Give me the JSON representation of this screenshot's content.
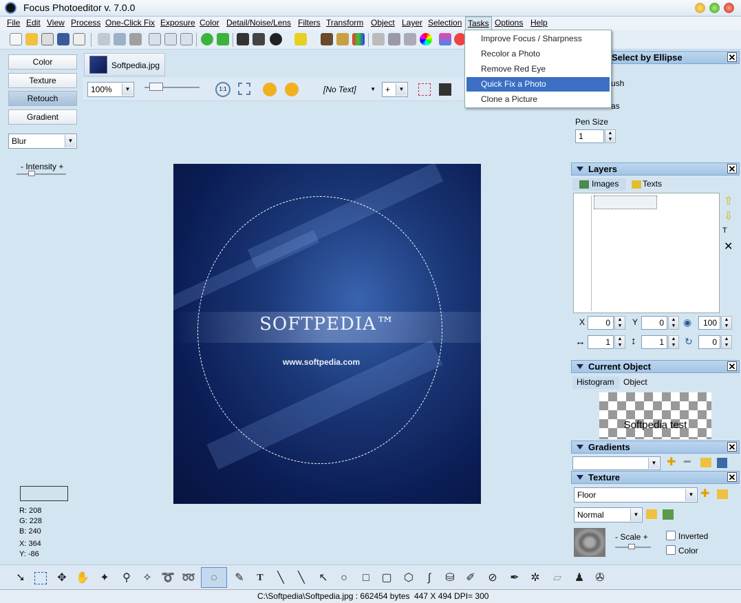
{
  "window": {
    "title": "Focus Photoeditor v. 7.0.0"
  },
  "menu": [
    "File",
    "Edit",
    "View",
    "Process",
    "One-Click Fix",
    "Exposure",
    "Color",
    "Detail/Noise/Lens",
    "Filters",
    "Transform",
    "Object",
    "Layer",
    "Selection",
    "Tasks",
    "Options",
    "Help"
  ],
  "tasks_menu": {
    "items": [
      "Improve Focus / Sharpness",
      "Recolor a Photo",
      "Remove Red Eye",
      "Quick Fix a Photo",
      "Clone a Picture"
    ],
    "selected": "Quick Fix a Photo"
  },
  "left_panel": {
    "buttons": [
      "Color",
      "Texture",
      "Retouch",
      "Gradient"
    ],
    "active": "Retouch",
    "effect_select": "Blur",
    "intensity_label": "- Intensity +",
    "pixel_info": {
      "r": "R: 208",
      "g": "G: 228",
      "b": "B: 240",
      "x": "X: 364",
      "y": "Y: -86"
    }
  },
  "document": {
    "tab_name": "Softpedia.jpg",
    "zoom": "100%",
    "text_select": "[No Text]",
    "plus_select": "+",
    "image_logo": "SOFTPEDIA™",
    "image_url": "www.softpedia.com"
  },
  "tool_panel": {
    "title": "Select by Ellipse",
    "brush_label": "ush",
    "canvas_label": "as",
    "pen_size_label": "Pen Size",
    "pen_size": "1"
  },
  "layers_panel": {
    "title": "Layers",
    "tabs": [
      "Images",
      "Texts"
    ],
    "x_label": "X",
    "x": "0",
    "y_label": "Y",
    "y": "0",
    "opacity": "100",
    "w": "1",
    "h": "1",
    "rot": "0"
  },
  "current_object": {
    "title": "Current Object",
    "tabs": [
      "Histogram",
      "Object"
    ],
    "preview_text": "Softpedia test"
  },
  "gradients_panel": {
    "title": "Gradients"
  },
  "texture_panel": {
    "title": "Texture",
    "texture": "Floor",
    "blend": "Normal",
    "scale_label": "- Scale +",
    "inverted": "Inverted",
    "color": "Color"
  },
  "status": {
    "path": "C:\\Softpedia\\Softpedia.jpg : 662454 bytes",
    "dims": "447 X 494 DPI= 300"
  },
  "colors": {
    "accent": "#3a6fc4",
    "panel_header": "#a3c5e6",
    "background": "#d4e5f2"
  }
}
